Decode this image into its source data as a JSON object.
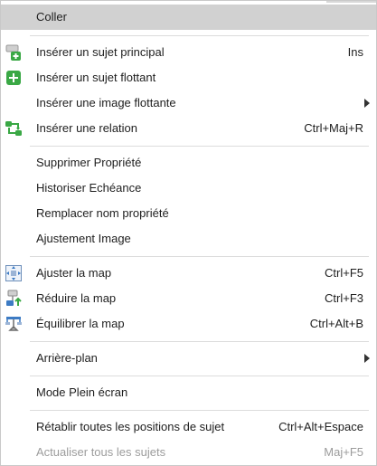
{
  "menu": {
    "items": [
      {
        "label": "Coller",
        "shortcut": "",
        "icon": "",
        "highlight": true
      },
      {
        "label": "Insérer un sujet principal",
        "shortcut": "Ins",
        "icon": "insert-main-topic-icon"
      },
      {
        "label": "Insérer un sujet flottant",
        "shortcut": "",
        "icon": "insert-floating-topic-icon"
      },
      {
        "label": "Insérer une image flottante",
        "shortcut": "",
        "icon": "",
        "submenu": true
      },
      {
        "label": "Insérer une relation",
        "shortcut": "Ctrl+Maj+R",
        "icon": "insert-relation-icon"
      },
      {
        "label": "Supprimer Propriété",
        "shortcut": "",
        "icon": ""
      },
      {
        "label": "Historiser Echéance",
        "shortcut": "",
        "icon": ""
      },
      {
        "label": "Remplacer nom propriété",
        "shortcut": "",
        "icon": ""
      },
      {
        "label": "Ajustement Image",
        "shortcut": "",
        "icon": ""
      },
      {
        "label": "Ajuster la map",
        "shortcut": "Ctrl+F5",
        "icon": "fit-map-icon"
      },
      {
        "label": "Réduire la map",
        "shortcut": "Ctrl+F3",
        "icon": "reduce-map-icon"
      },
      {
        "label": "Équilibrer la map",
        "shortcut": "Ctrl+Alt+B",
        "icon": "balance-map-icon"
      },
      {
        "label": "Arrière-plan",
        "shortcut": "",
        "icon": "",
        "submenu": true
      },
      {
        "label": "Mode Plein écran",
        "shortcut": "",
        "icon": ""
      },
      {
        "label": "Rétablir toutes les positions de sujet",
        "shortcut": "Ctrl+Alt+Espace",
        "icon": ""
      },
      {
        "label": "Actualiser tous les sujets",
        "shortcut": "Maj+F5",
        "icon": "",
        "disabled": true
      }
    ]
  },
  "colors": {
    "highlight": "#d1d1d1",
    "text": "#1e1e1e",
    "disabled_text": "#9c9c9c",
    "green_icon": "#3aa845",
    "blue_icon": "#3d7bc4"
  }
}
